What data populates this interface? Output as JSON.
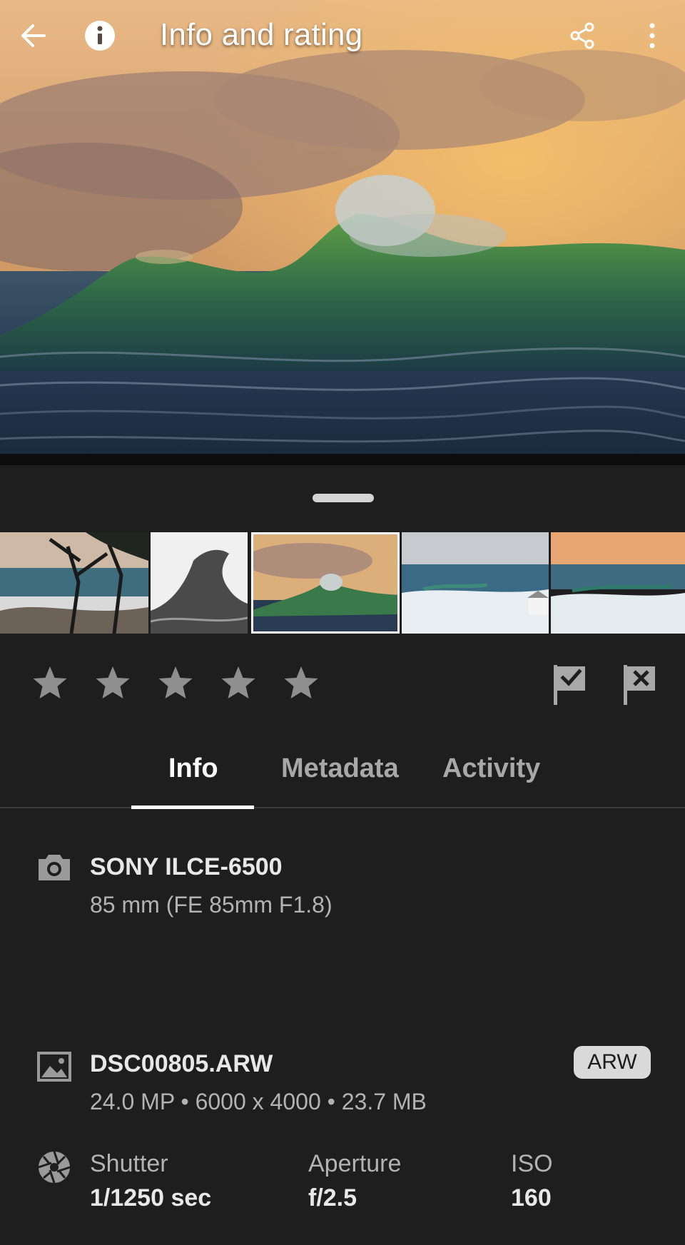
{
  "appbar": {
    "title": "Info and rating",
    "icons": [
      "back-arrow-icon",
      "info-icon",
      "share-icon",
      "more-vert-icon"
    ]
  },
  "filmstrip": {
    "thumbnails": [
      {
        "subject": "tree-shoreline"
      },
      {
        "subject": "bw-wave"
      },
      {
        "subject": "sunset-wave",
        "selected": true
      },
      {
        "subject": "snowy-coast-cabin"
      },
      {
        "subject": "snowy-coast-sunset"
      }
    ]
  },
  "rating": {
    "stars": 5,
    "value": 0,
    "star_color": "#8f8f8f"
  },
  "flags": {
    "pick_icon": "flag-pick-icon",
    "reject_icon": "flag-reject-icon"
  },
  "tabs": [
    {
      "label": "Info",
      "active": true
    },
    {
      "label": "Metadata",
      "active": false
    },
    {
      "label": "Activity",
      "active": false
    }
  ],
  "camera": {
    "model": "SONY ILCE-6500",
    "lens": "85 mm (FE 85mm F1.8)"
  },
  "file": {
    "name": "DSC00805.ARW",
    "details": "24.0 MP • 6000 x 4000 • 23.7 MB",
    "format_badge": "ARW"
  },
  "exposure": {
    "shutter_label": "Shutter",
    "shutter_value": "1/1250 sec",
    "aperture_label": "Aperture",
    "aperture_value": "f/2.5",
    "iso_label": "ISO",
    "iso_value": "160"
  },
  "colors": {
    "background": "#1e1e1e",
    "text_primary": "#e8e8e8",
    "text_secondary": "#b3b3b3",
    "tab_underline": "#ffffff"
  }
}
